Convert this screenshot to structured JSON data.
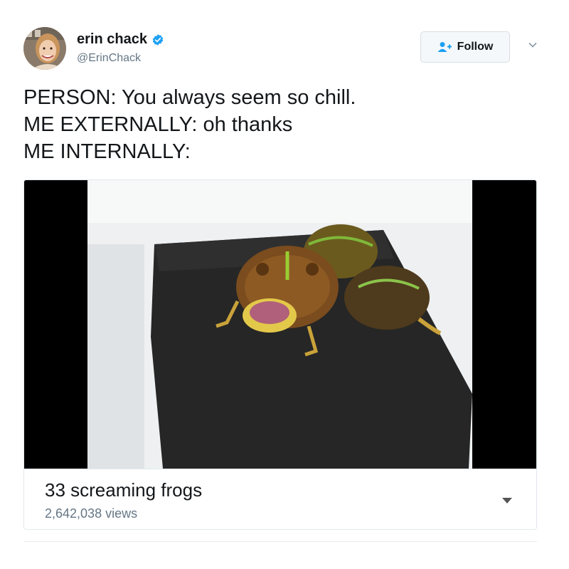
{
  "user": {
    "name": "erin chack",
    "handle": "@ErinChack",
    "verified": true
  },
  "follow_button": {
    "label": "Follow",
    "icon": "add-user-icon"
  },
  "tweet": {
    "lines": [
      "PERSON: You always seem so chill.",
      "ME EXTERNALLY: oh thanks",
      "ME INTERNALLY:"
    ]
  },
  "video_card": {
    "title": "33 screaming frogs",
    "views": "2,642,038 views"
  },
  "colors": {
    "verified_blue": "#1da1f2",
    "text_primary": "#14171a",
    "text_secondary": "#657786",
    "border": "#e1e8ed"
  }
}
